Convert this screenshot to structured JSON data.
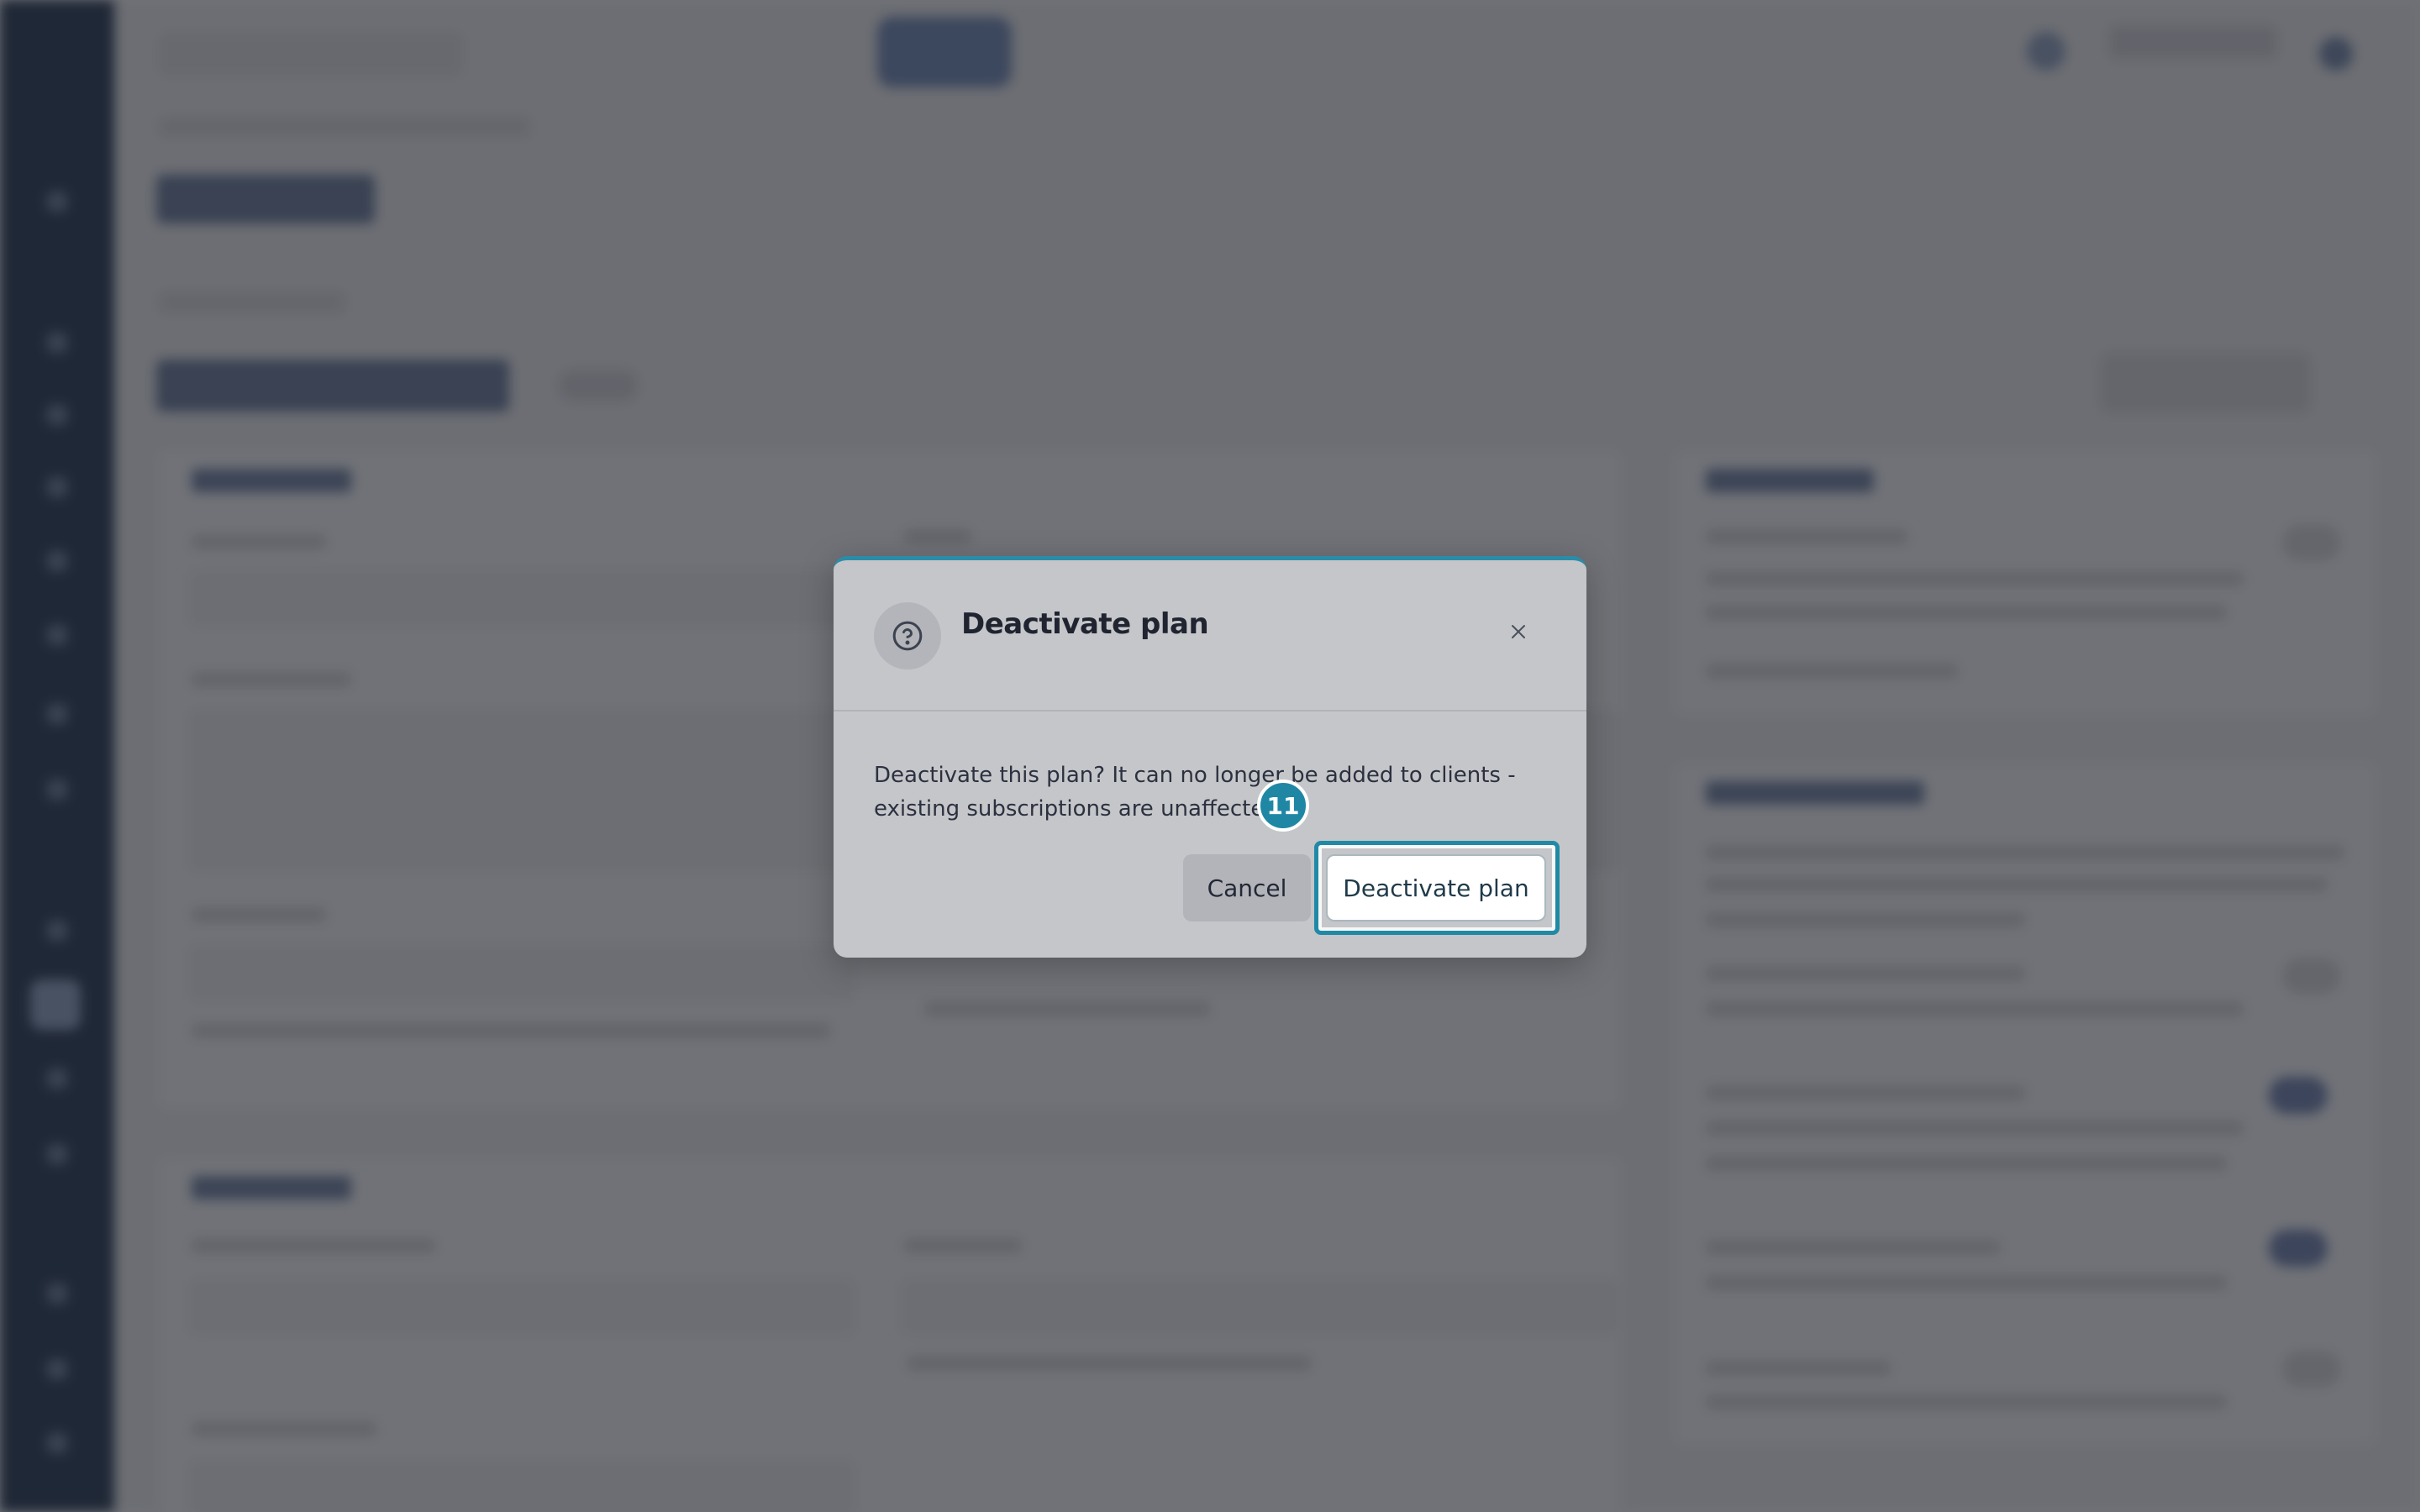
{
  "dialog": {
    "title": "Deactivate plan",
    "message": "Deactivate this plan? It can no longer be added to clients - existing subscriptions are unaffected.",
    "cancel_label": "Cancel",
    "confirm_label": "Deactivate plan",
    "icons": {
      "header": "help-circle-icon",
      "close": "close-icon"
    }
  },
  "annotation": {
    "step_number": "11"
  },
  "colors": {
    "accent": "#208aa6",
    "sidebar": "#1b2535",
    "dialog_bg": "#c5c6c9",
    "confirm_bg": "#ffffff",
    "cancel_bg": "#b2b4b9"
  }
}
